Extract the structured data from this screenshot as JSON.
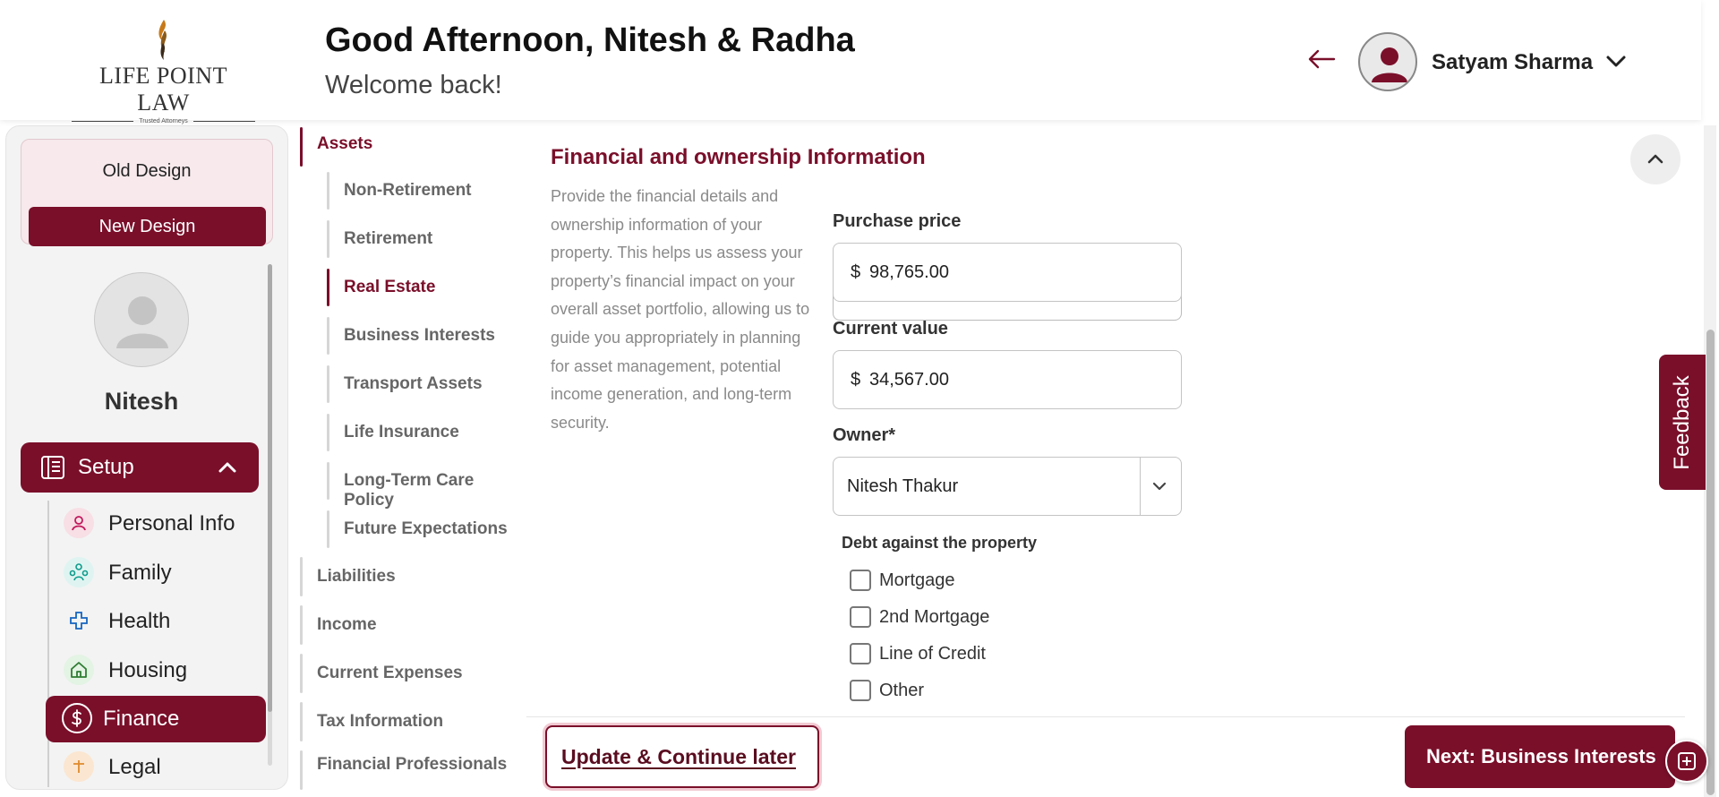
{
  "header": {
    "brand": {
      "name": "LIFE POINT LAW",
      "tagline": "Trusted Attorneys"
    },
    "greeting": "Good Afternoon, Nitesh & Radha",
    "subtitle": "Welcome back!",
    "user_name": "Satyam Sharma"
  },
  "design_toggle": {
    "old": "Old Design",
    "new": "New Design"
  },
  "profile": {
    "name": "Nitesh"
  },
  "sidebar": {
    "section": "Setup",
    "items": [
      {
        "label": "Personal Info",
        "icon": "person-icon",
        "color": "#c2185b"
      },
      {
        "label": "Family",
        "icon": "family-icon",
        "color": "#0e9b8c"
      },
      {
        "label": "Health",
        "icon": "health-cross-icon",
        "color": "#1565c0"
      },
      {
        "label": "Housing",
        "icon": "house-icon",
        "color": "#2e7d32"
      },
      {
        "label": "Finance",
        "icon": "dollar-icon",
        "color": "#ffffff"
      },
      {
        "label": "Legal",
        "icon": "legal-icon",
        "color": "#e08a2c"
      }
    ],
    "active_item": "Finance"
  },
  "subnav": {
    "assets": "Assets",
    "asset_items": [
      "Non-Retirement",
      "Retirement",
      "Real Estate",
      "Business Interests",
      "Transport Assets",
      "Life Insurance",
      "Long-Term Care Policy",
      "Future Expectations"
    ],
    "active": "Real Estate",
    "sections": [
      "Liabilities",
      "Income",
      "Current Expenses",
      "Tax Information",
      "Financial Professionals"
    ]
  },
  "form": {
    "title": "Financial and ownership Information",
    "description": "Provide the financial details and ownership information of your property. This helps us assess your property’s financial impact on your overall asset portfolio, allowing us to guide you appropriately in planning for asset management, potential income generation, and long-term security.",
    "purchase_price": {
      "label": "Purchase price",
      "currency": "$",
      "value": "98,765.00"
    },
    "current_value": {
      "label": "Current value",
      "currency": "$",
      "value": "34,567.00"
    },
    "owner": {
      "label": "Owner*",
      "value": "Nitesh Thakur"
    },
    "debt": {
      "label": "Debt against the property",
      "options": [
        {
          "label": "Mortgage",
          "checked": false
        },
        {
          "label": "2nd Mortgage",
          "checked": false
        },
        {
          "label": "Line of Credit",
          "checked": false
        },
        {
          "label": "Other",
          "checked": false
        }
      ]
    }
  },
  "actions": {
    "update": "Update & Continue later",
    "next": "Next: Business Interests"
  },
  "feedback": "Feedback",
  "colors": {
    "brand": "#7a0f2a",
    "brand_light": "#f7e9ec"
  }
}
